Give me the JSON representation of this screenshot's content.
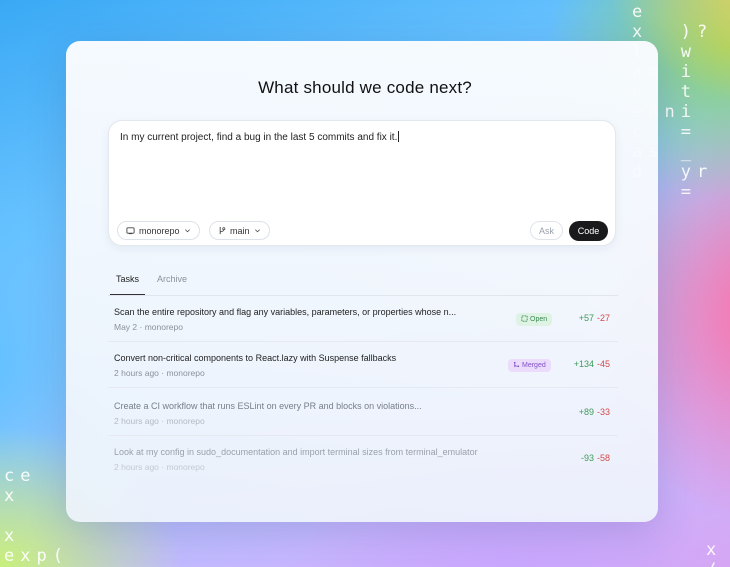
{
  "headline": "What should we code next?",
  "prompt": {
    "value": "In my current project, find a bug in the last 5 commits and fix it."
  },
  "composer": {
    "repo_chip": "monorepo",
    "branch_chip": "main",
    "ask_label": "Ask",
    "code_label": "Code"
  },
  "tabs": [
    {
      "label": "Tasks",
      "active": true
    },
    {
      "label": "Archive",
      "active": false
    }
  ],
  "tasks": [
    {
      "title": "Scan the entire repository and flag any variables, parameters, or properties whose n...",
      "meta": "May 2 · monorepo",
      "status": "Open",
      "additions": "+57",
      "deletions": "-27"
    },
    {
      "title": "Convert non-critical components to React.lazy with Suspense fallbacks",
      "meta": "2 hours ago · monorepo",
      "status": "Merged",
      "additions": "+134",
      "deletions": "-45"
    },
    {
      "title": "Create a CI workflow that runs ESLint on every PR and blocks on violations...",
      "meta": "2 hours ago · monorepo",
      "status": "",
      "additions": "+89",
      "deletions": "-33"
    },
    {
      "title": "Look at my config in sudo_documentation and import terminal sizes from terminal_emulator",
      "meta": "2 hours ago · monorepo",
      "status": "",
      "additions": "-93",
      "deletions": "-58"
    }
  ],
  "decorations": {
    "top_right": "e\nx  )?\nl  w\nam i\nn  t\neani\nc  =\nas _\nd  yr\n   =",
    "bottom_left": "ce\nx\n\nx\nexp(\nreturn ex",
    "bottom_right": "x\n/"
  },
  "colors": {
    "code_button": "#1a1a1c",
    "open_badge": "#dff3e4",
    "merged_badge": "#ecdcfb",
    "additions": "#3f9a5a",
    "deletions": "#d24a4a"
  }
}
